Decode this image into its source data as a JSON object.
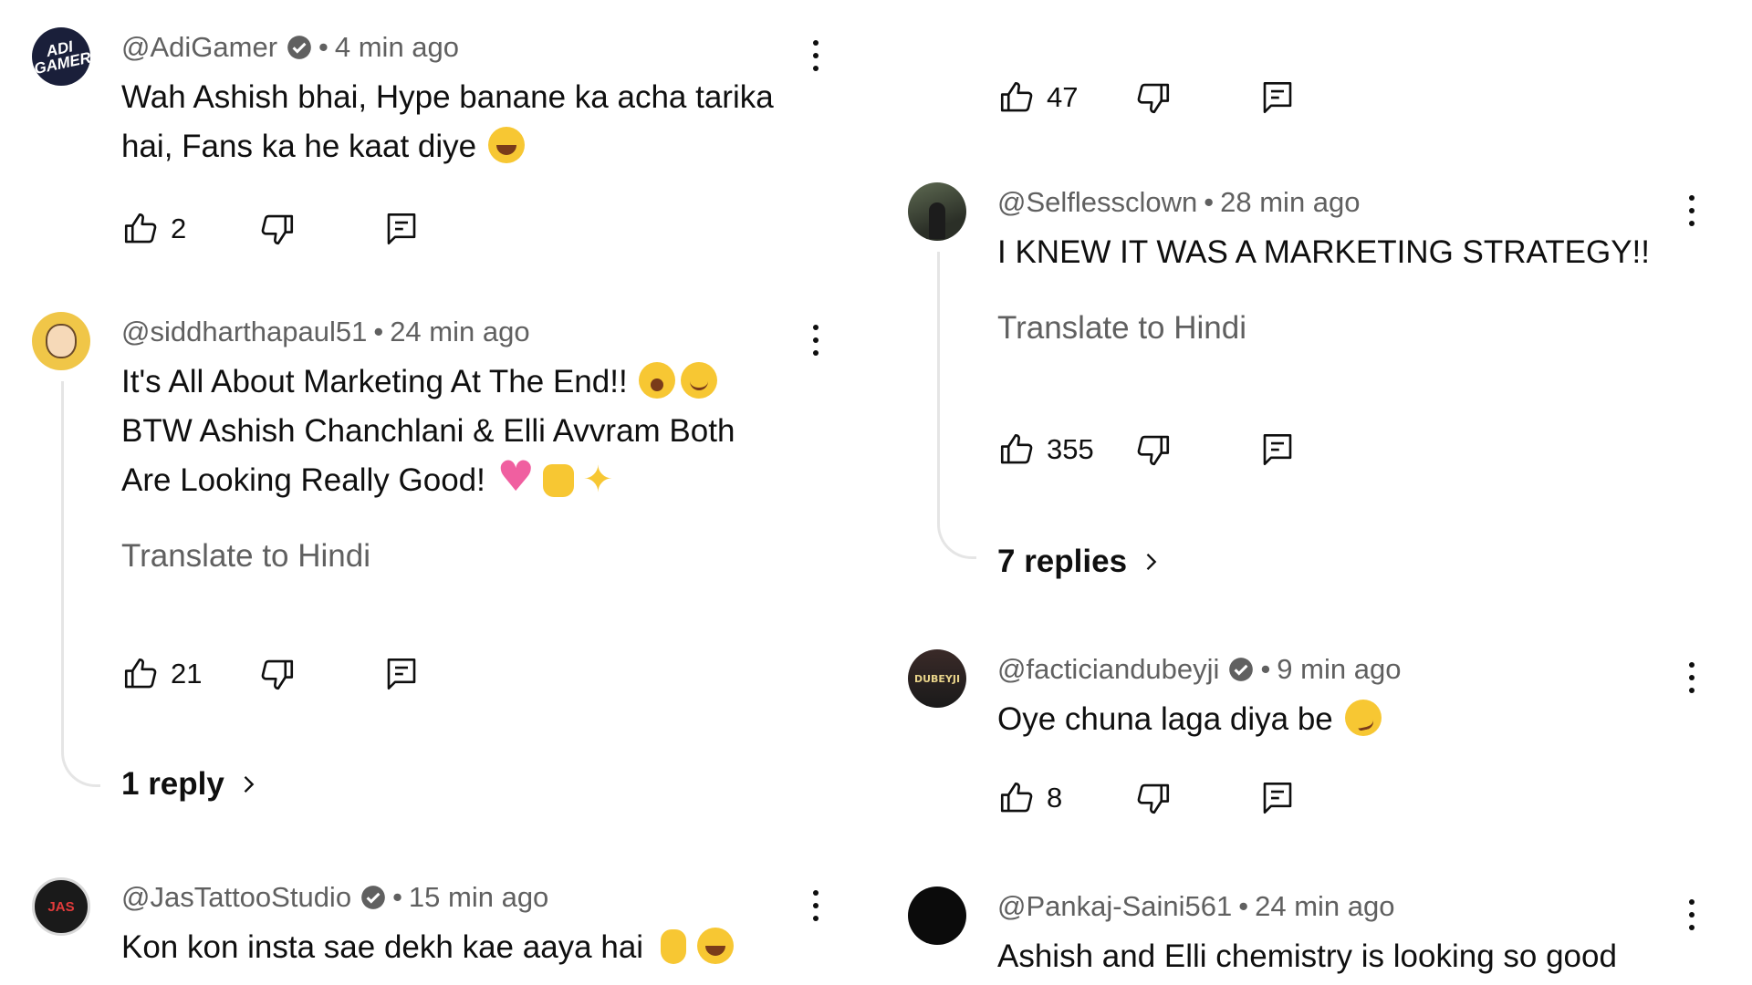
{
  "icons": {
    "like": "thumb-up-icon",
    "dislike": "thumb-down-icon",
    "reply": "comment-reply-icon",
    "more": "more-vert-icon",
    "verified": "verified-badge-icon",
    "chevron": "chevron-right-icon"
  },
  "colors": {
    "text": "#0f0f0f",
    "muted": "#606060",
    "thread_line": "#e5e5e5"
  },
  "left": {
    "c1": {
      "handle": "@AdiGamer",
      "verified": true,
      "sep": "•",
      "time": "4 min ago",
      "avatar_text": "ADI GAMER",
      "text": "Wah Ashish bhai, Hype banane ka acha tarika hai, Fans ka he kaat diye",
      "emojis": [
        "😂"
      ],
      "likes": "2"
    },
    "c2": {
      "handle": "@siddharthapaul51",
      "verified": false,
      "sep": "•",
      "time": "24 min ago",
      "text_l1": "It's All About Marketing At The End!!",
      "text_l2": "BTW Ashish Chanchlani & Elli Avvram Both",
      "text_l3": "Are Looking Really Good!",
      "emojis": [
        "🥱",
        "🙂",
        "💖",
        "🙌",
        "✨"
      ],
      "translate": "Translate to Hindi",
      "likes": "21",
      "replies": "1 reply"
    },
    "c3": {
      "handle": "@JasTattooStudio",
      "verified": true,
      "sep": "•",
      "time": "15 min ago",
      "avatar_text": "JAS",
      "text": "Kon kon insta sae dekh kae aaya hai",
      "emojis": [
        "🖐",
        "😂"
      ]
    }
  },
  "right": {
    "c0": {
      "likes": "47"
    },
    "c1": {
      "handle": "@Selflessclown",
      "verified": false,
      "sep": "•",
      "time": "28 min ago",
      "text": "I KNEW IT WAS A MARKETING STRATEGY!!",
      "translate": "Translate to Hindi",
      "likes": "355",
      "replies": "7 replies"
    },
    "c2": {
      "handle": "@facticiandubeyji",
      "verified": true,
      "sep": "•",
      "time": "9 min ago",
      "avatar_text": "DUBEYJI",
      "text": "Oye chuna laga diya be",
      "emojis": [
        "😏"
      ],
      "likes": "8"
    },
    "c3": {
      "handle": "@Pankaj-Saini561",
      "verified": false,
      "sep": "•",
      "time": "24 min ago",
      "text": "Ashish and Elli chemistry is looking so good"
    }
  }
}
